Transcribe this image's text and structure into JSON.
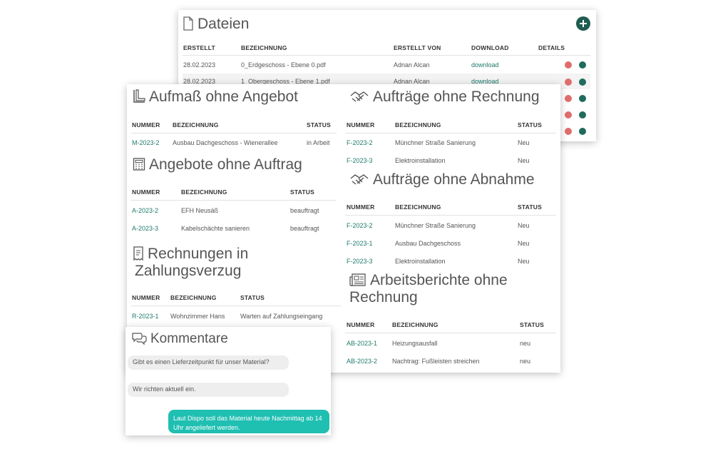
{
  "dateien": {
    "title": "Dateien",
    "headers": [
      "ERSTELLT",
      "BEZEICHNUNG",
      "ERSTELLT VON",
      "DOWNLOAD",
      "DETAILS"
    ],
    "rows": [
      {
        "date": "28.02.2023",
        "name": "0_Erdgeschoss - Ebene 0.pdf",
        "by": "Adnan Alcan",
        "download": "download"
      },
      {
        "date": "28.02.2023",
        "name": "1_Obergeschoss - Ebene 1.pdf",
        "by": "Adnan Alcan",
        "download": "download"
      }
    ]
  },
  "aufmass": {
    "title": "Aufmaß ohne Angebot",
    "headers": [
      "NUMMER",
      "BEZEICHNUNG",
      "STATUS"
    ],
    "rows": [
      {
        "nr": "M-2023-2",
        "name": "Ausbau Dachgeschoss - Wienerallee",
        "status": "in Arbeit"
      }
    ]
  },
  "angebote": {
    "title": "Angebote ohne Auftrag",
    "headers": [
      "NUMMER",
      "BEZEICHNUNG",
      "STATUS"
    ],
    "rows": [
      {
        "nr": "A-2023-2",
        "name": "EFH Neusäß",
        "status": "beauftragt"
      },
      {
        "nr": "A-2023-3",
        "name": "Kabelschächte sanieren",
        "status": "beauftragt"
      }
    ]
  },
  "rechnungen": {
    "title_line1": "Rechnungen in",
    "title_line2": "Zahlungsverzug",
    "headers": [
      "NUMMER",
      "BEZEICHNUNG",
      "STATUS"
    ],
    "rows": [
      {
        "nr": "R-2023-1",
        "name": "Wohnzimmer Hans",
        "status": "Warten auf Zahlungseingang"
      }
    ]
  },
  "auftraege_rechnung": {
    "title": "Aufträge ohne Rechnung",
    "headers": [
      "NUMMER",
      "BEZEICHNUNG",
      "STATUS"
    ],
    "rows": [
      {
        "nr": "F-2023-2",
        "name": "Münchner Straße Sanierung",
        "status": "Neu"
      },
      {
        "nr": "F-2023-3",
        "name": "Elektroinstallation",
        "status": "Neu"
      }
    ]
  },
  "auftraege_abnahme": {
    "title": "Aufträge ohne Abnahme",
    "headers": [
      "NUMMER",
      "BEZEICHNUNG",
      "STATUS"
    ],
    "rows": [
      {
        "nr": "F-2023-2",
        "name": "Münchner Straße Sanierung",
        "status": "Neu"
      },
      {
        "nr": "F-2023-1",
        "name": "Ausbau Dachgeschoss",
        "status": "Neu"
      },
      {
        "nr": "F-2023-3",
        "name": "Elektroinstallation",
        "status": "Neu"
      }
    ]
  },
  "arbeitsberichte": {
    "title_line1": "Arbeitsberichte ohne",
    "title_line2": "Rechnung",
    "headers": [
      "NUMMER",
      "BEZEICHNUNG",
      "STATUS"
    ],
    "rows": [
      {
        "nr": "AB-2023-1",
        "name": "Heizungsausfall",
        "status": "neu"
      },
      {
        "nr": "AB-2023-2",
        "name": "Nachtrag: Fußleisten streichen",
        "status": "neu"
      }
    ]
  },
  "kommentare": {
    "title": "Kommentare",
    "messages": [
      "Gibt es einen Lieferzeitpunkt für unser Material?",
      "Wir richten aktuell ein.",
      "Laut Dispo soll das Material heute Nachmittag ab 14 Uhr angeliefert werden."
    ]
  },
  "icons": [
    "file-icon",
    "plus-icon",
    "ruler-icon",
    "calculator-icon",
    "invoice-icon",
    "handshake-icon",
    "newspaper-icon",
    "chat-icon",
    "delete-icon",
    "search-icon"
  ],
  "colors": {
    "accent": "#1f6b5d",
    "link": "#1f7a6b",
    "danger": "#e06d6d",
    "bubble_out": "#1fbfb2"
  }
}
